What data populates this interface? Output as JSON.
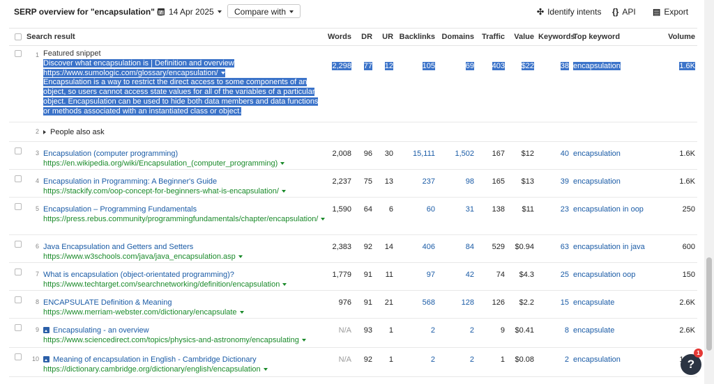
{
  "header": {
    "title": "SERP overview for \"encapsulation\"",
    "date": "14 Apr 2025",
    "compare_label": "Compare with",
    "identify_label": "Identify intents",
    "api_label": "API",
    "export_label": "Export"
  },
  "columns": {
    "search_result": "Search result",
    "words": "Words",
    "dr": "DR",
    "ur": "UR",
    "backlinks": "Backlinks",
    "domains": "Domains",
    "traffic": "Traffic",
    "value": "Value",
    "keywords": "Keywords",
    "top_keyword": "Top keyword",
    "volume": "Volume"
  },
  "featured": {
    "num": "1",
    "label": "Featured snippet",
    "title": "Discover what encapsulation is | Definition and overview",
    "url": "https://www.sumologic.com/glossary/encapsulation/",
    "text_lines": [
      "Encapsulation is a way to restrict the direct access to some components of an",
      "object, so users cannot access state values for all of the variables of a particular",
      "object. Encapsulation can be used to hide both data members and data functions",
      "or methods associated with an instantiated class or object."
    ],
    "words": "2,298",
    "dr": "77",
    "ur": "12",
    "backlinks": "105",
    "domains": "69",
    "traffic": "403",
    "value": "$22",
    "keywords": "38",
    "top_keyword": "encapsulation",
    "volume": "1.6K"
  },
  "paa": {
    "num": "2",
    "label": "People also ask"
  },
  "rows": [
    {
      "num": "3",
      "title": "Encapsulation (computer programming)",
      "url": "https://en.wikipedia.org/wiki/Encapsulation_(computer_programming)",
      "words": "2,008",
      "dr": "96",
      "ur": "30",
      "backlinks": "15,111",
      "domains": "1,502",
      "traffic": "167",
      "value": "$12",
      "keywords": "40",
      "top_keyword": "encapsulation",
      "volume": "1.6K"
    },
    {
      "num": "4",
      "title": "Encapsulation in Programming: A Beginner's Guide",
      "url": "https://stackify.com/oop-concept-for-beginners-what-is-encapsulation/",
      "words": "2,237",
      "dr": "75",
      "ur": "13",
      "backlinks": "237",
      "domains": "98",
      "traffic": "165",
      "value": "$13",
      "keywords": "39",
      "top_keyword": "encapsulation",
      "volume": "1.6K"
    },
    {
      "num": "5",
      "title": "Encapsulation – Programming Fundamentals",
      "url": "https://press.rebus.community/programmingfundamentals/chapter/encapsulation/",
      "words": "1,590",
      "dr": "64",
      "ur": "6",
      "backlinks": "60",
      "domains": "31",
      "traffic": "138",
      "value": "$11",
      "keywords": "23",
      "top_keyword": "encapsulation in oop",
      "volume": "250"
    },
    {
      "num": "6",
      "title": "Java Encapsulation and Getters and Setters",
      "url": "https://www.w3schools.com/java/java_encapsulation.asp",
      "words": "2,383",
      "dr": "92",
      "ur": "14",
      "backlinks": "406",
      "domains": "84",
      "traffic": "529",
      "value": "$0.94",
      "keywords": "63",
      "top_keyword": "encapsulation in java",
      "volume": "600"
    },
    {
      "num": "7",
      "title": "What is encapsulation (object-orientated programming)?",
      "url": "https://www.techtarget.com/searchnetworking/definition/encapsulation",
      "words": "1,779",
      "dr": "91",
      "ur": "11",
      "backlinks": "97",
      "domains": "42",
      "traffic": "74",
      "value": "$4.3",
      "keywords": "25",
      "top_keyword": "encapsulation oop",
      "volume": "150"
    },
    {
      "num": "8",
      "title": "ENCAPSULATE Definition & Meaning",
      "url": "https://www.merriam-webster.com/dictionary/encapsulate",
      "words": "976",
      "dr": "91",
      "ur": "21",
      "backlinks": "568",
      "domains": "128",
      "traffic": "126",
      "value": "$2.2",
      "keywords": "15",
      "top_keyword": "encapsulate",
      "volume": "2.6K"
    },
    {
      "num": "9",
      "title": "Encapsulating - an overview",
      "url": "https://www.sciencedirect.com/topics/physics-and-astronomy/encapsulating",
      "words": "N/A",
      "dr": "93",
      "ur": "1",
      "backlinks": "2",
      "domains": "2",
      "traffic": "9",
      "value": "$0.41",
      "keywords": "8",
      "top_keyword": "encapsulate",
      "volume": "2.6K"
    },
    {
      "num": "10",
      "title": "Meaning of encapsulation in English - Cambridge Dictionary",
      "url": "https://dictionary.cambridge.org/dictionary/english/encapsulation",
      "words": "N/A",
      "dr": "92",
      "ur": "1",
      "backlinks": "2",
      "domains": "2",
      "traffic": "1",
      "value": "$0.08",
      "keywords": "2",
      "top_keyword": "encapsulation",
      "volume": "1.6K"
    }
  ],
  "help": {
    "label": "?",
    "badge": "1"
  }
}
